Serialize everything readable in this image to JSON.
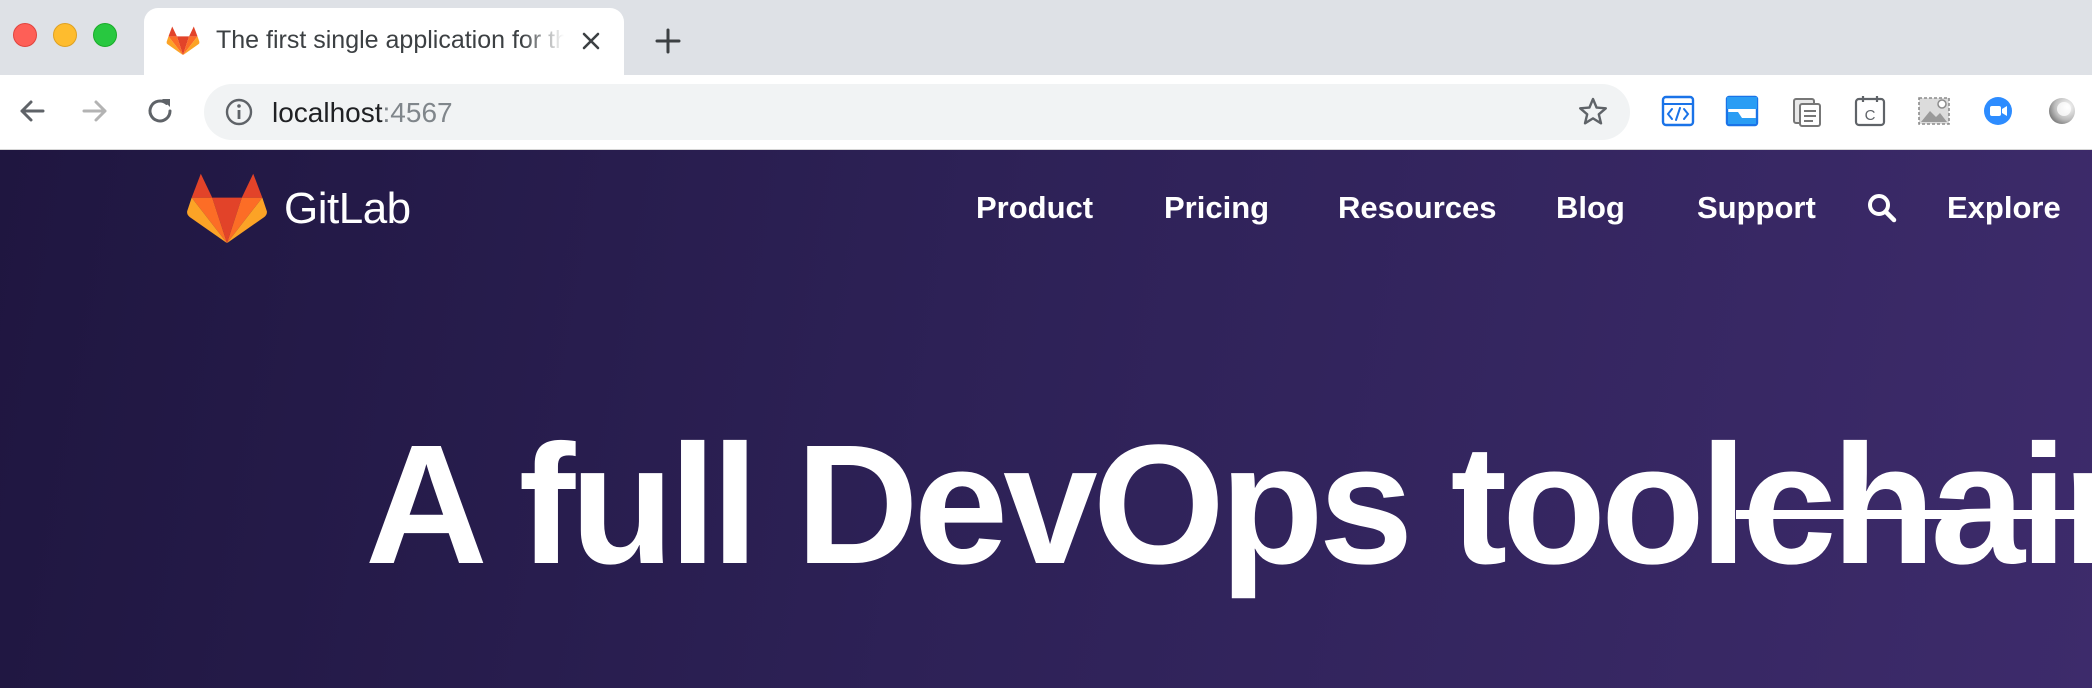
{
  "browser": {
    "tab": {
      "title": "The first single application for the entire DevOps lifecycle"
    },
    "address_bar": {
      "host": "localhost",
      "port": ":4567"
    },
    "extensions": [
      "code-viewer-icon",
      "window-capture-icon",
      "clipboard-icon",
      "calendar-c-icon",
      "image-icon",
      "zoom-icon",
      "sphere-icon"
    ]
  },
  "site": {
    "logo_text": "GitLab",
    "nav": {
      "product": "Product",
      "pricing": "Pricing",
      "resources": "Resources",
      "blog": "Blog",
      "support": "Support",
      "explore": "Explore"
    },
    "hero": {
      "text_main": "A full DevOps tool",
      "text_struck": "chain",
      "text_tail": "."
    }
  },
  "colors": {
    "page_background_start": "#1f1640",
    "page_background_end": "#3d2b6b",
    "gitlab_orange": "#fc6d26",
    "gitlab_red": "#e24329",
    "gitlab_yellow": "#fca326"
  }
}
